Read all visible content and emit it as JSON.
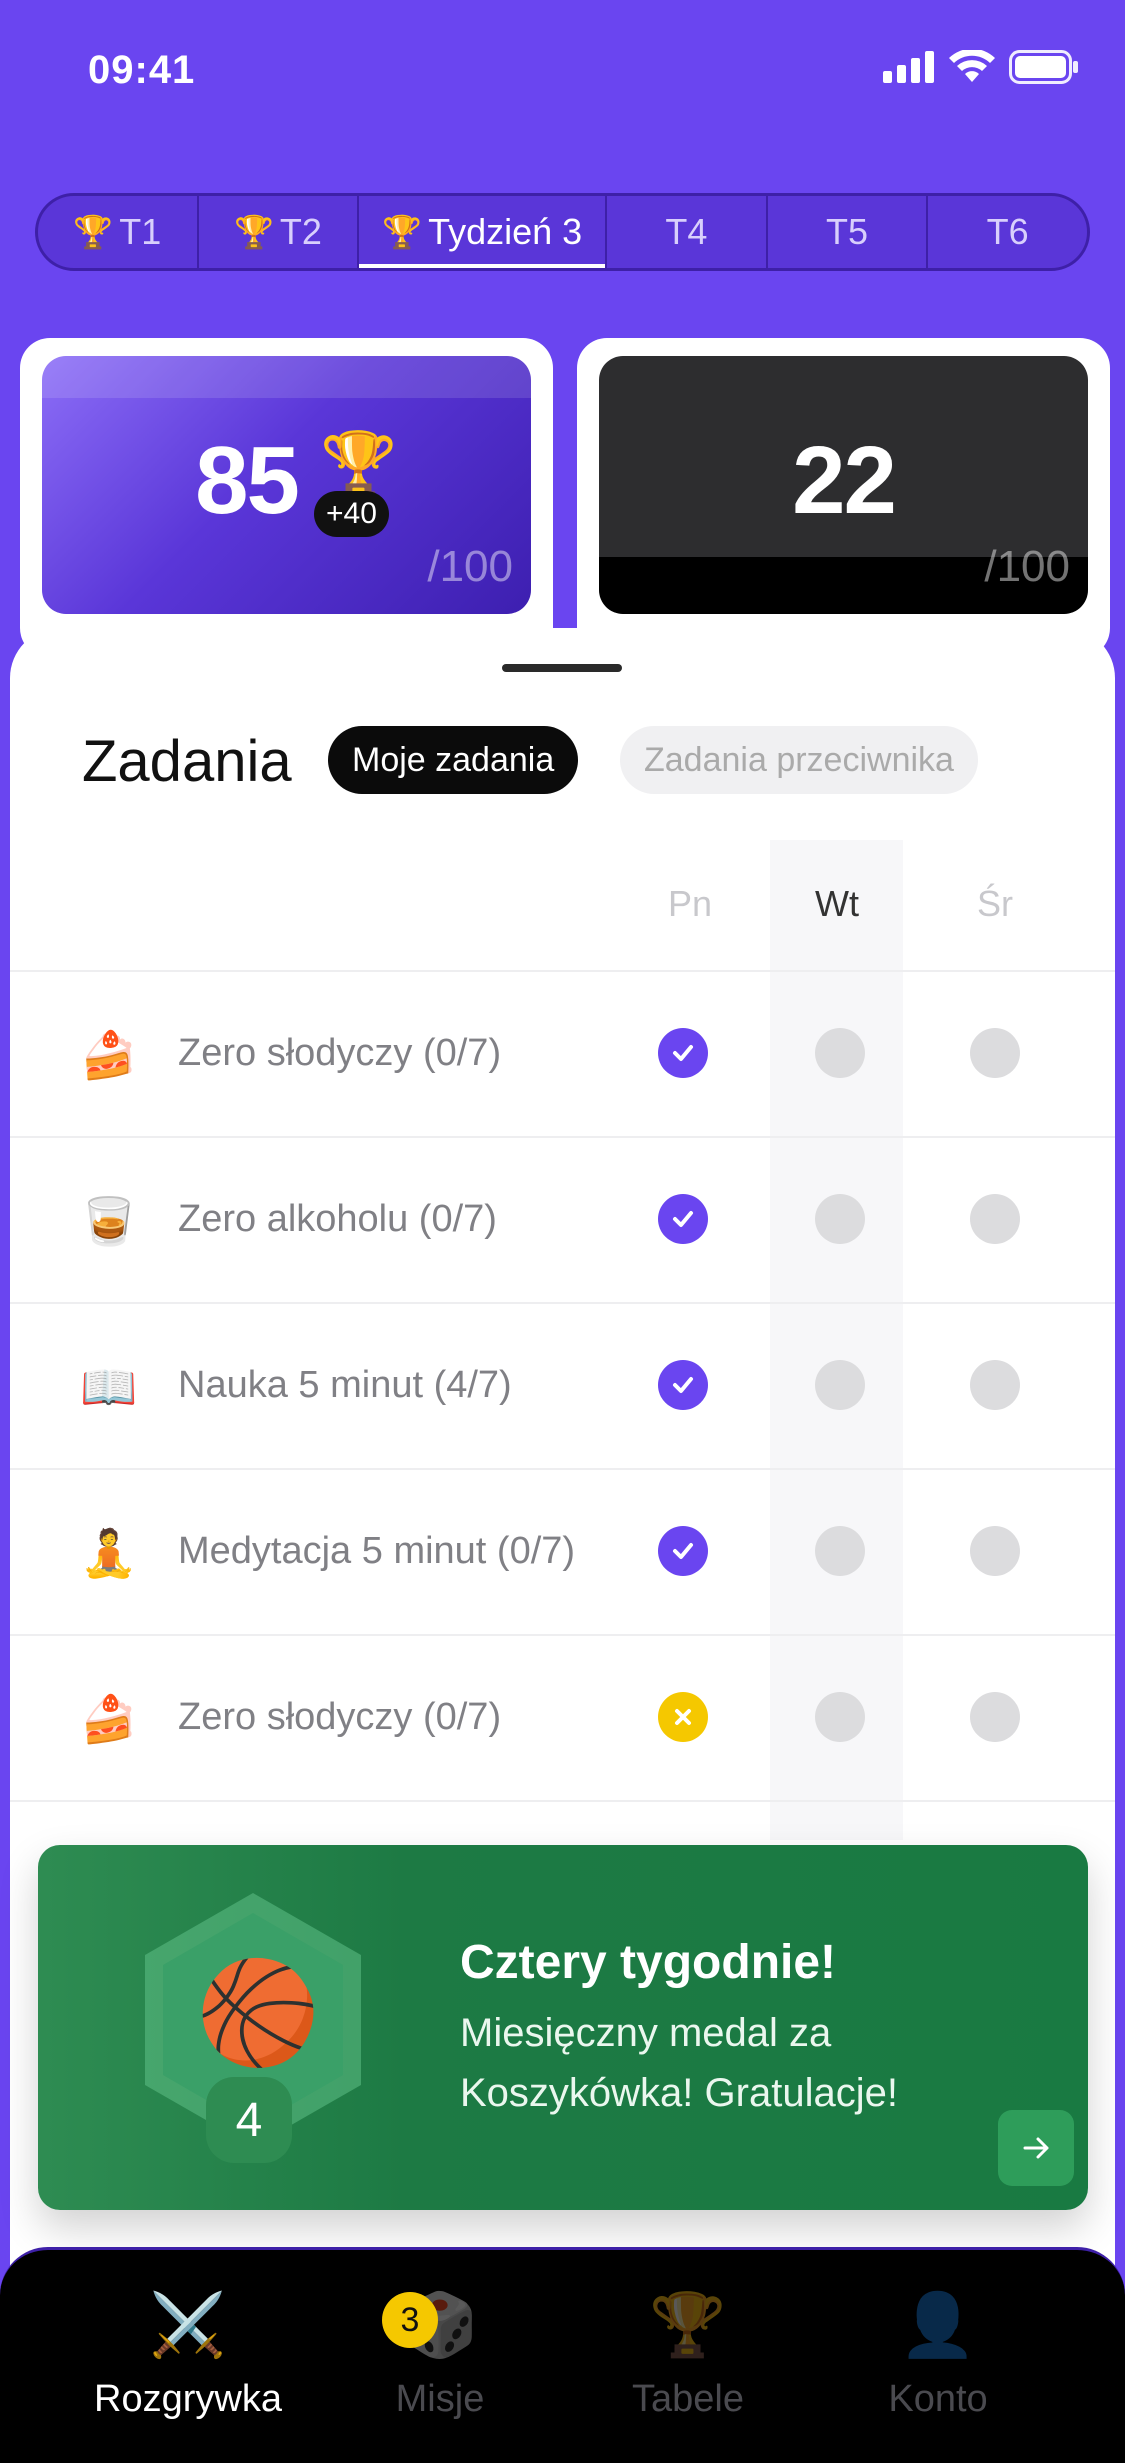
{
  "status_bar": {
    "time": "09:41"
  },
  "week_tabs": [
    {
      "label": "T1",
      "icon": "trophy-icon",
      "active": false
    },
    {
      "label": "T2",
      "icon": "trophy-icon",
      "active": false
    },
    {
      "label": "Tydzień 3",
      "icon": "trophy-icon",
      "active": true
    },
    {
      "label": "T4",
      "active": false
    },
    {
      "label": "T5",
      "active": false
    },
    {
      "label": "T6",
      "active": false
    }
  ],
  "scores": {
    "me": {
      "value": "85",
      "bonus": "+40",
      "max": "/100",
      "icon": "trophy-icon",
      "color": "#6a45f0"
    },
    "opponent": {
      "value": "22",
      "max": "/100",
      "color": "#2d2d2f"
    }
  },
  "tasks_section": {
    "title": "Zadania",
    "filters": {
      "mine": "Moje zadania",
      "opponent": "Zadania przeciwnika",
      "selected": "mine"
    },
    "days": [
      "Pn",
      "Wt",
      "Śr"
    ],
    "active_day": "Wt",
    "tasks": [
      {
        "icon": "cake-icon",
        "emoji": "🍰",
        "label": "Zero słodyczy (0/7)",
        "status": [
          "done",
          "empty",
          "empty"
        ]
      },
      {
        "icon": "whiskey-icon",
        "emoji": "🥃",
        "label": "Zero alkoholu (0/7)",
        "status": [
          "done",
          "empty",
          "empty"
        ]
      },
      {
        "icon": "book-icon",
        "emoji": "📖",
        "label": "Nauka 5 minut (4/7)",
        "status": [
          "done",
          "empty",
          "empty"
        ]
      },
      {
        "icon": "meditation-icon",
        "emoji": "🧘",
        "label": "Medytacja 5 minut (0/7)",
        "status": [
          "done",
          "empty",
          "empty"
        ]
      },
      {
        "icon": "cake-icon",
        "emoji": "🍰",
        "label": "Zero słodyczy (0/7)",
        "status": [
          "failed",
          "empty",
          "empty"
        ]
      }
    ]
  },
  "banner": {
    "title": "Cztery tygodnie!",
    "text": "Miesięczny medal za Koszykówka! Gratulacje!",
    "medal_count": "4",
    "medal_icon": "basketball-icon",
    "color": "#1d7a44"
  },
  "tab_bar": {
    "items": [
      {
        "label": "Rozgrywka",
        "icon": "crossed-swords-icon",
        "glyph": "⚔️",
        "active": true
      },
      {
        "label": "Misje",
        "icon": "dice-icon",
        "glyph": "🎲",
        "badge": "3",
        "active": false
      },
      {
        "label": "Tabele",
        "icon": "trophy-icon",
        "glyph": "🏆",
        "active": false
      },
      {
        "label": "Konto",
        "icon": "user-icon",
        "glyph": "👤",
        "active": false
      }
    ]
  }
}
